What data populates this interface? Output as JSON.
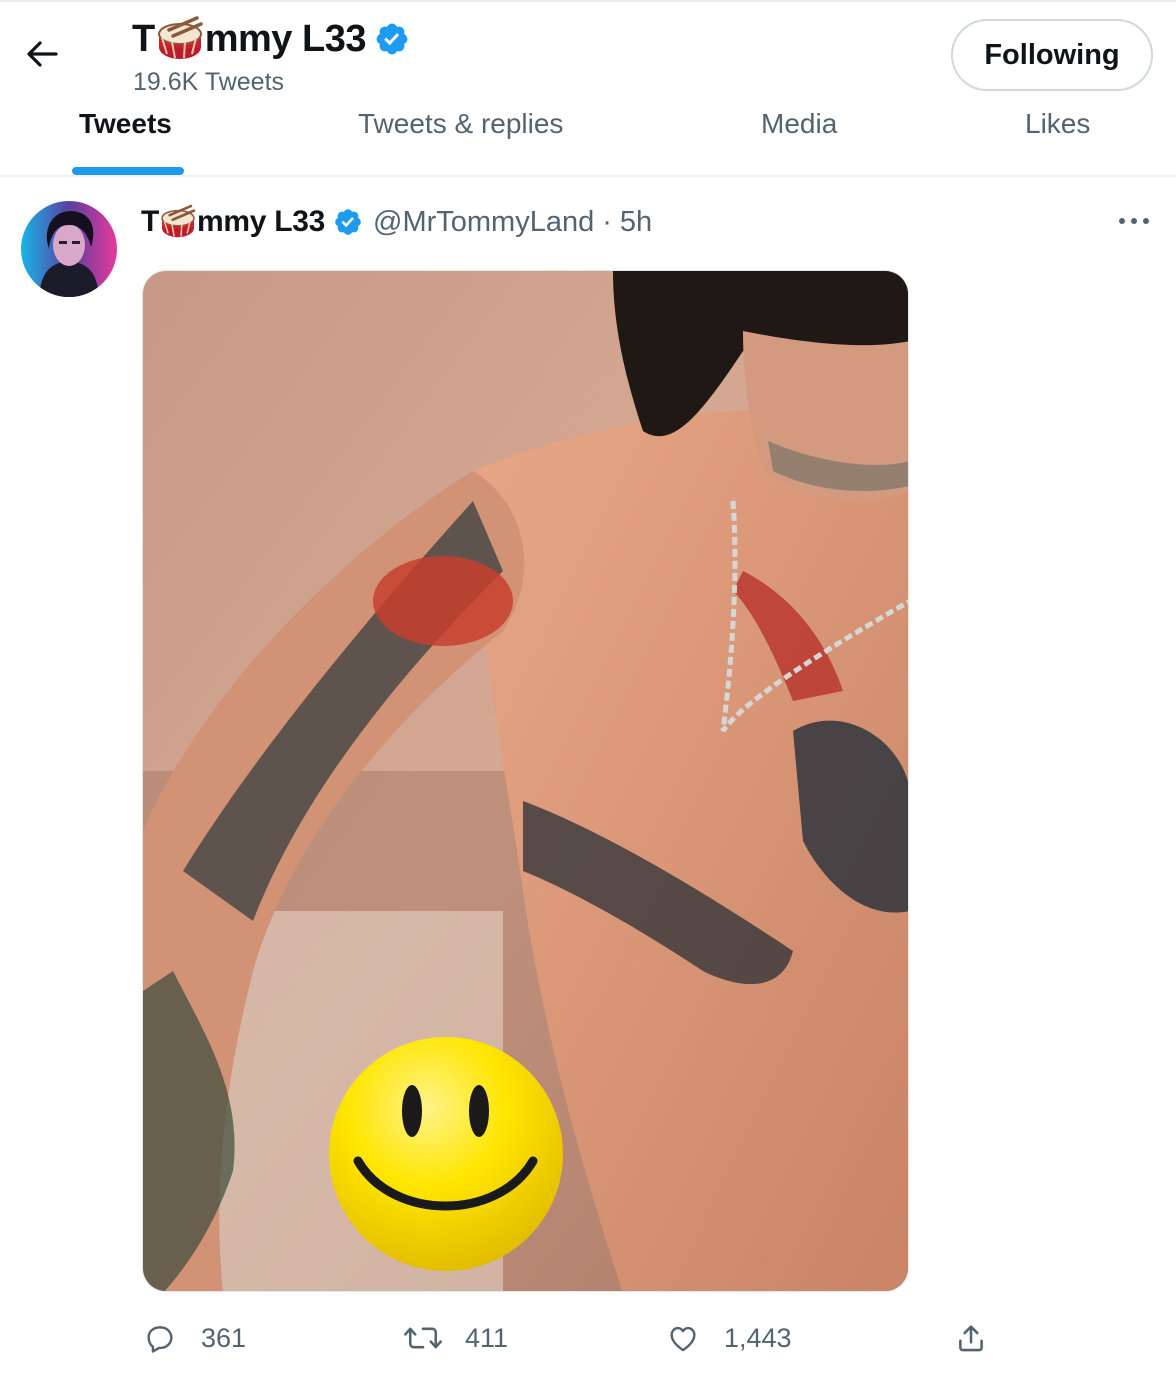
{
  "header": {
    "name_prefix": "T",
    "name_suffix": "mmy L33",
    "tweet_count": "19.6K Tweets",
    "follow_label": "Following",
    "back_icon": "back-arrow-icon"
  },
  "tabs": [
    {
      "label": "Tweets",
      "active": true
    },
    {
      "label": "Tweets & replies",
      "active": false
    },
    {
      "label": "Media",
      "active": false
    },
    {
      "label": "Likes",
      "active": false
    }
  ],
  "tweet": {
    "name_prefix": "T",
    "name_suffix": "mmy L33",
    "handle": "@MrTommyLand",
    "separator": "·",
    "time": "5h",
    "actions": {
      "replies": "361",
      "retweets": "411",
      "likes": "1,443"
    }
  },
  "colors": {
    "accent": "#1d9bf0",
    "text": "#0f1419",
    "muted": "#536471",
    "verified": "#1d9bf0"
  }
}
